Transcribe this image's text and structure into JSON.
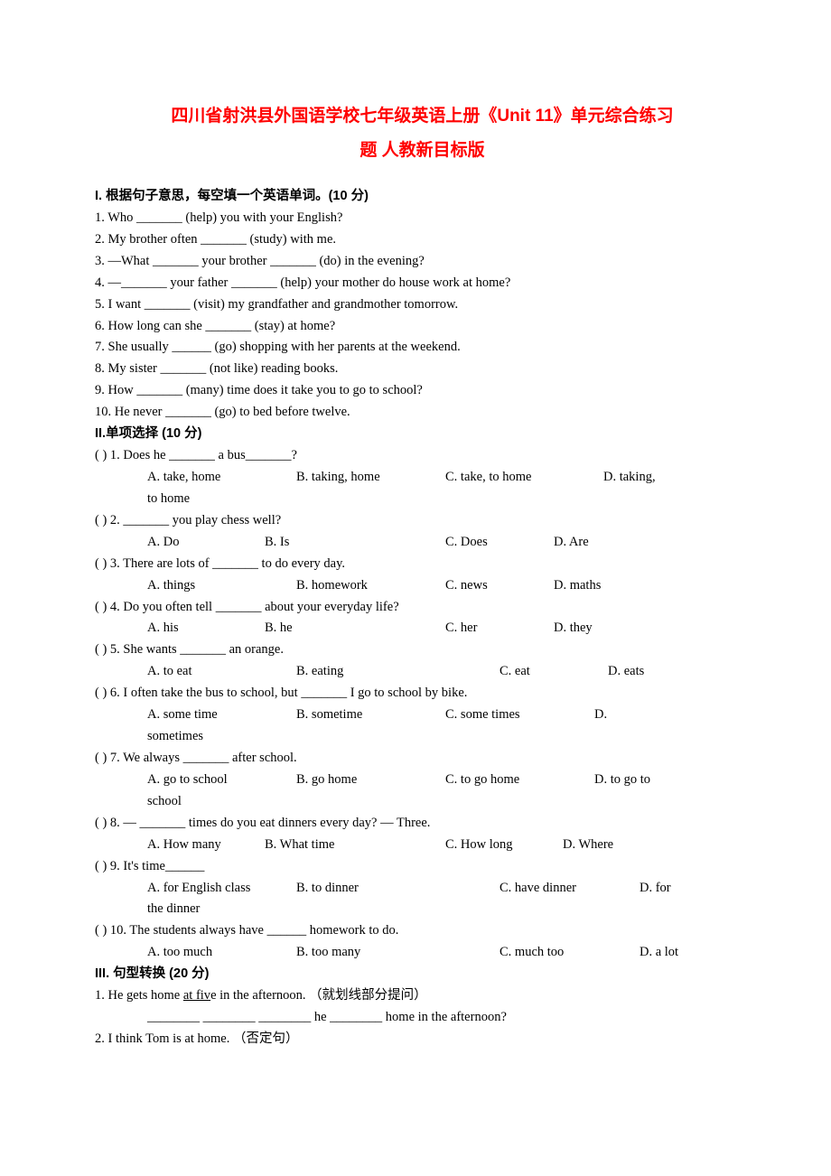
{
  "title_line1": "四川省射洪县外国语学校七年级英语上册《Unit 11》单元综合练习",
  "title_line2": "题 人教新目标版",
  "sec1": {
    "head": "I. 根据句子意思，每空填一个英语单词。(10 分)",
    "q1": "1. Who _______ (help) you with your English?",
    "q2": "2. My brother often _______ (study) with me.",
    "q3": "3. —What _______ your brother _______ (do) in the evening?",
    "q4": "4. —_______ your father _______ (help) your mother do house work at home?",
    "q5": "5. I want _______ (visit) my grandfather and grandmother tomorrow.",
    "q6": "6. How long can she _______ (stay) at home?",
    "q7": "7. She usually ______ (go) shopping with her parents at the weekend.",
    "q8": "8. My sister _______ (not like) reading books.",
    "q9": "9. How _______ (many) time does it take you to go to school?",
    "q10": "10. He never _______ (go) to bed before twelve."
  },
  "sec2": {
    "head": "II.单项选择 (10 分)",
    "q1": {
      "stem": "(   ) 1. Does he _______ a bus_______?",
      "a": "A. take, home",
      "b": "B. taking, home",
      "c": "C. take, to home",
      "d": "D.  taking,",
      "d2": "to home"
    },
    "q2": {
      "stem": "(   ) 2. _______ you play chess well?",
      "a": "A. Do",
      "b": "B. Is",
      "c": "C. Does",
      "d": "D. Are"
    },
    "q3": {
      "stem": "(   ) 3. There are lots of _______ to do every day.",
      "a": "A. things",
      "b": "B. homework",
      "c": "C. news",
      "d": "D. maths"
    },
    "q4": {
      "stem": "(   ) 4. Do you often tell _______ about your everyday life?",
      "a": "A. his",
      "b": "B. he",
      "c": "C. her",
      "d": "D. they"
    },
    "q5": {
      "stem": "(   ) 5. She wants _______ an orange.",
      "a": "A. to eat",
      "b": "B. eating",
      "c": "C. eat",
      "d": "D. eats"
    },
    "q6": {
      "stem": "(   ) 6. I often take the bus to school, but _______ I go to school by bike.",
      "a": "A. some time",
      "b": "B. sometime",
      "c": "C. some times",
      "d": "D.",
      "d2": "sometimes"
    },
    "q7": {
      "stem": "(   ) 7. We always _______ after school.",
      "a": "A. go to school",
      "b": "B. go home",
      "c": "C. to go home",
      "d": "D. to go to",
      "d2": "school"
    },
    "q8": {
      "stem": "(   ) 8. — _______ times do you eat dinners every day?  — Three.",
      "a": "A. How many",
      "b": "B. What time",
      "c": "C. How long",
      "d": "D. Where"
    },
    "q9": {
      "stem": "(   ) 9. It's time______",
      "a": "A. for English class",
      "b": "B. to dinner",
      "c": "C. have dinner",
      "d": "D.  for",
      "d2": "the dinner"
    },
    "q10": {
      "stem": "(   ) 10. The students always have ______ homework to do.",
      "a": "A. too much",
      "b": "B. too many",
      "c": "C. much too",
      "d": "D. a lot"
    }
  },
  "sec3": {
    "head": "III. 句型转换 (20 分)",
    "q1_a": "1. He gets home ",
    "q1_u": "at fiv",
    "q1_b": "e in the afternoon. （就划线部分提问）",
    "q1_ans": "________ ________ ________ he ________ home in the afternoon?",
    "q2": "2. I think Tom is at home. （否定句）"
  }
}
